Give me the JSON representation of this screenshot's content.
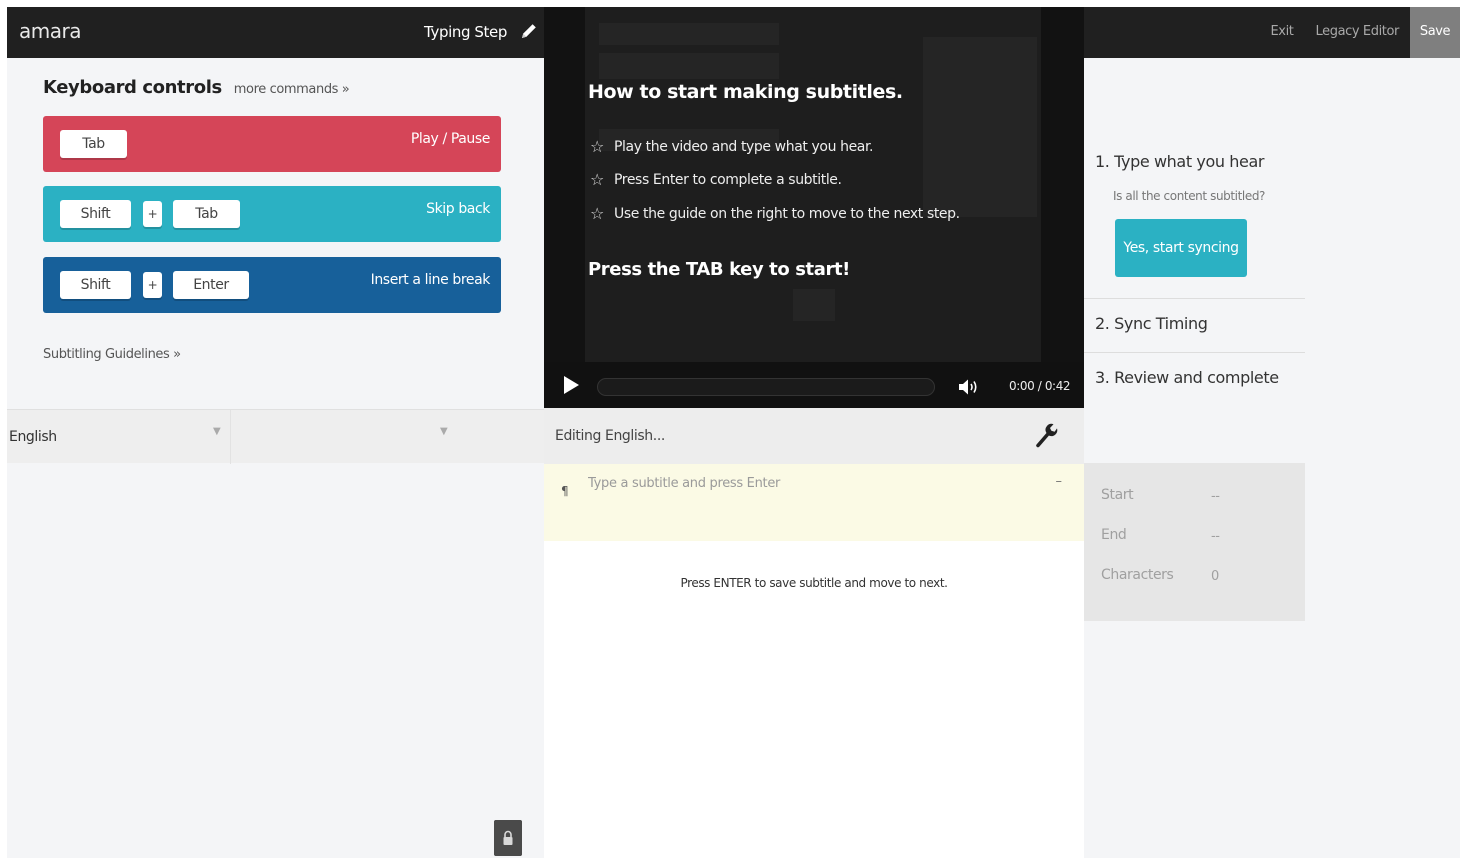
{
  "header": {
    "logo": "amara",
    "step": "Typing Step",
    "exit": "Exit",
    "legacy_editor": "Legacy Editor",
    "save": "Save"
  },
  "keyboard": {
    "title": "Keyboard controls",
    "more": "more commands »",
    "rows": [
      {
        "keys": [
          "Tab"
        ],
        "action": "Play / Pause",
        "color": "#d54558"
      },
      {
        "keys": [
          "Shift",
          "+",
          "Tab"
        ],
        "action": "Skip back",
        "color": "#2bb1c3"
      },
      {
        "keys": [
          "Shift",
          "+",
          "Enter"
        ],
        "action": "Insert a line break",
        "color": "#17609a"
      }
    ],
    "guidelines": "Subtitling Guidelines »"
  },
  "language": {
    "selected": "English",
    "secondary": ""
  },
  "video": {
    "overlay_title": "How to start making subtitles.",
    "items": [
      "Play the video and type what you hear.",
      "Press Enter to complete a subtitle.",
      "Use the guide on the right to move to the next step."
    ],
    "cta": "Press the TAB key to start!",
    "time": "0:00 / 0:42",
    "progress": 0
  },
  "editor": {
    "heading": "Editing English...",
    "placeholder": "Type a subtitle and press Enter",
    "pilcrow": "¶",
    "dash": "–",
    "hint": "Press ENTER to save subtitle and move to next."
  },
  "guide": {
    "step1": "1. Type what you hear",
    "question": "Is all the content subtitled?",
    "button": "Yes, start syncing",
    "step2": "2. Sync Timing",
    "step3": "3. Review and complete"
  },
  "stats": {
    "start_label": "Start",
    "start_value": "--",
    "end_label": "End",
    "end_value": "--",
    "chars_label": "Characters",
    "chars_value": "0"
  },
  "icons": {
    "pencil": "pencil-icon",
    "play": "play-icon",
    "volume": "volume-icon",
    "wrench": "wrench-icon",
    "star": "star-outline-icon",
    "lock": "lock-icon"
  }
}
